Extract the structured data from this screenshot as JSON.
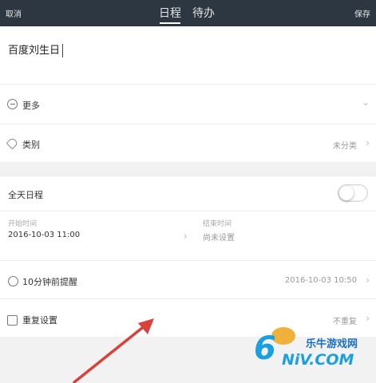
{
  "topbar": {
    "cancel_label": "取消",
    "save_label": "保存",
    "tabs": [
      {
        "label": "日程"
      },
      {
        "label": "待办"
      }
    ]
  },
  "title": {
    "value": "百度刘生日"
  },
  "more": {
    "label": "更多",
    "icon": "minus-circle-icon"
  },
  "category": {
    "label": "类别",
    "value": "未分类",
    "icon": "tag-icon"
  },
  "all_day": {
    "label": "全天日程",
    "enabled": false
  },
  "time": {
    "start_label": "开始时间",
    "start_value": "2016-10-03 11:00",
    "end_label": "结束时间",
    "end_value": "尚未设置"
  },
  "reminder": {
    "label": "10分钟前提醒",
    "value": "2016-10-03 10:50",
    "icon": "bell-icon"
  },
  "repeat": {
    "label": "重复设置",
    "value": "不重复",
    "icon": "repeat-icon"
  },
  "watermark": {
    "brand_cn": "乐牛游戏网",
    "brand_en": "NiV.COM",
    "digit": "6"
  },
  "colors": {
    "topbar_bg": "#2c3742",
    "arrow": "#d9423a",
    "watermark": "#1a9fe0"
  }
}
